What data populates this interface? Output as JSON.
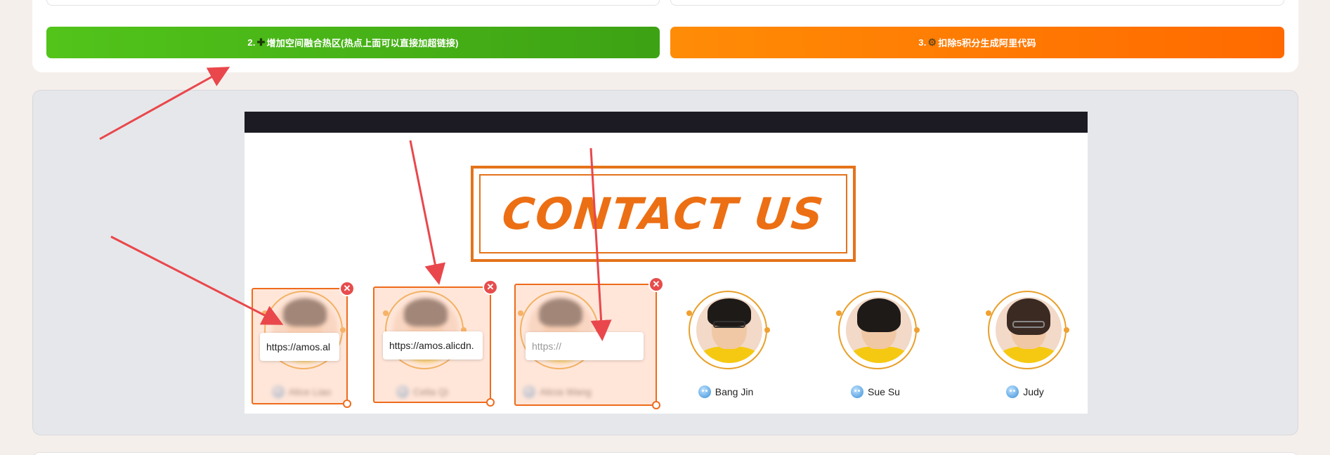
{
  "toolbar": {
    "hotspot_button_label": "2.➕增加空间融合热区(热点上面可以直接加超链接)",
    "generate_button_label": "3.⚙️扣除5积分生成阿里代码",
    "hotspot_prefix": "2.",
    "hotspot_icon": "plus-icon",
    "hotspot_text": "增加空间融合热区(热点上面可以直接加超链接)",
    "generate_prefix": "3.",
    "generate_icon": "gear-icon",
    "generate_text": "扣除5积分生成阿里代码"
  },
  "canvas": {
    "heading": "CONTACT US",
    "members": [
      {
        "name": "Alice Liao",
        "blurred": true
      },
      {
        "name": "Celia Qi",
        "blurred": true
      },
      {
        "name": "Alicia Wang",
        "blurred": true
      },
      {
        "name": "Bang Jin",
        "blurred": false
      },
      {
        "name": "Sue Su",
        "blurred": false
      },
      {
        "name": "Judy",
        "blurred": false
      }
    ]
  },
  "hotspots": [
    {
      "url_value": "https://amos.al",
      "placeholder": "https://"
    },
    {
      "url_value": "https://amos.alicdn.",
      "placeholder": "https://"
    },
    {
      "url_value": "",
      "placeholder": "https://"
    }
  ],
  "colors": {
    "green_button": "#52c41a",
    "orange_button": "#ff7a00",
    "hotspot_border": "#ee6b1c",
    "delete_badge": "#e74c4c",
    "annotation_arrow": "#e9474c"
  }
}
